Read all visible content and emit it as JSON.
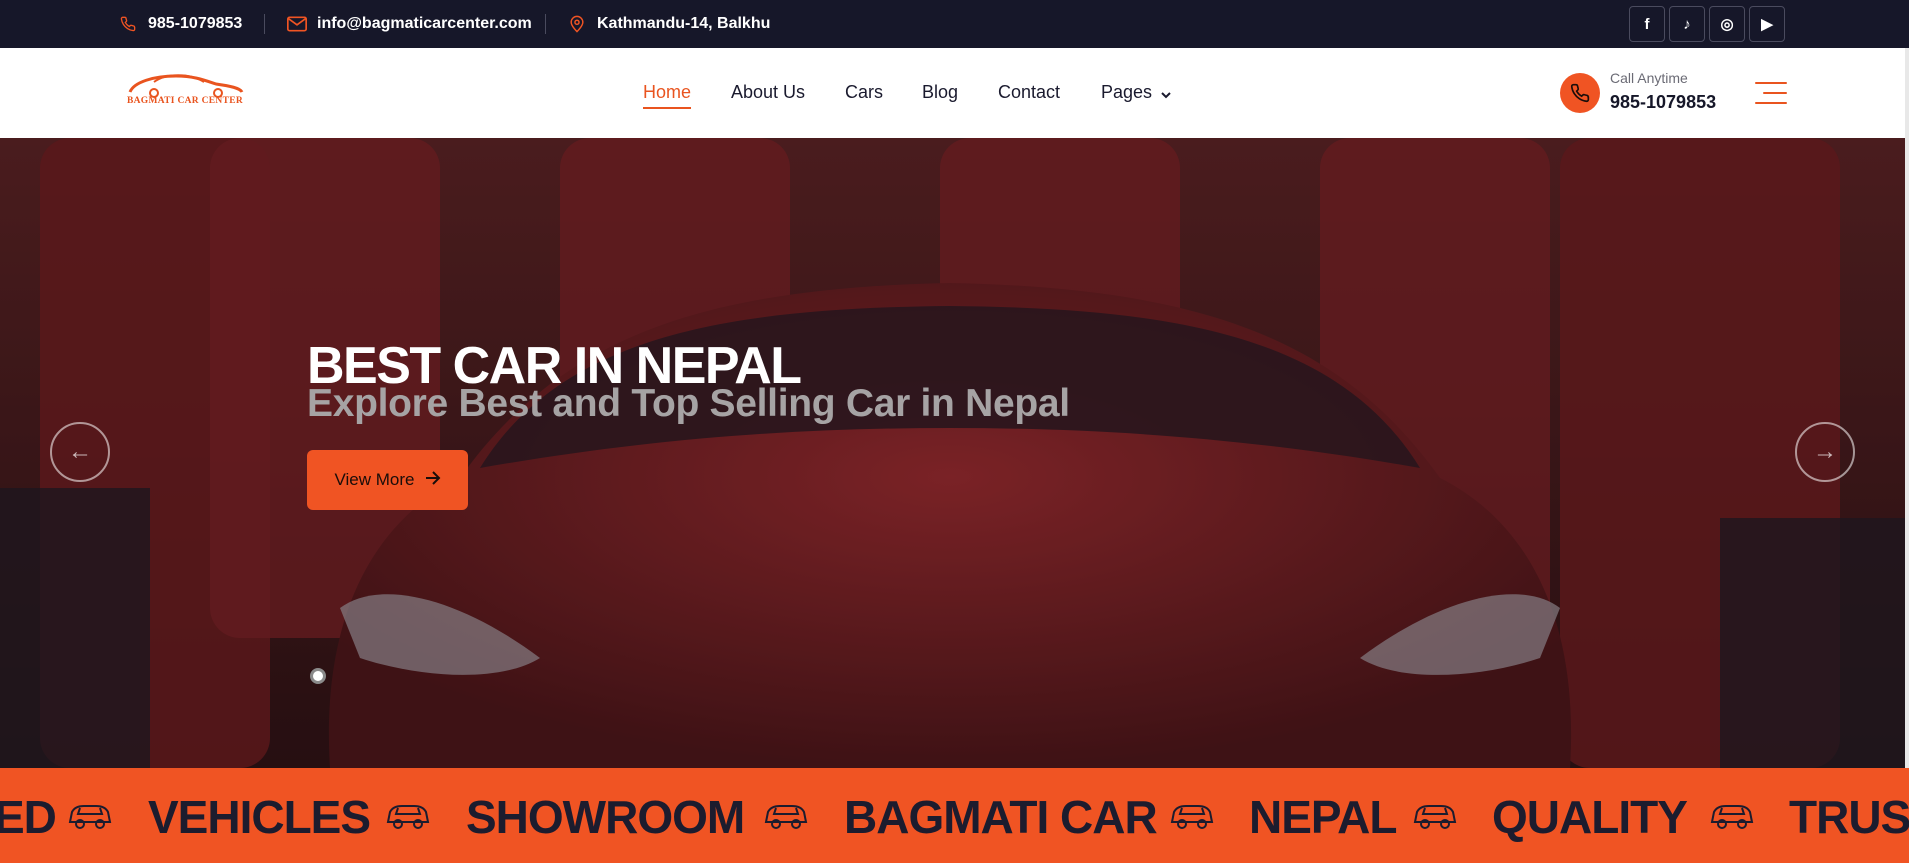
{
  "topbar": {
    "phone": "985-1079853",
    "email": "info@bagmaticarcenter.com",
    "address": "Kathmandu-14, Balkhu",
    "social": [
      {
        "name": "facebook",
        "glyph": "f"
      },
      {
        "name": "tiktok",
        "glyph": "♪"
      },
      {
        "name": "instagram",
        "glyph": "◎"
      },
      {
        "name": "youtube",
        "glyph": "▶"
      }
    ]
  },
  "header": {
    "logo_text": "BAGMATI CAR CENTER",
    "nav": [
      "Home",
      "About Us",
      "Cars",
      "Blog",
      "Contact",
      "Pages"
    ],
    "active_nav": "Home",
    "call_label": "Call Anytime",
    "call_number": "985-1079853"
  },
  "hero": {
    "title": "BEST CAR IN NEPAL",
    "subtitle": "Explore Best and Top Selling Car in Nepal",
    "button": "View More",
    "prev_icon": "←",
    "next_icon": "→"
  },
  "marquee": {
    "words": [
      "ED",
      "VEHICLES",
      "SHOWROOM",
      "BAGMATI CAR",
      "NEPAL",
      "QUALITY",
      "TRUS"
    ]
  },
  "colors": {
    "accent": "#f05423",
    "dark": "#161729"
  }
}
